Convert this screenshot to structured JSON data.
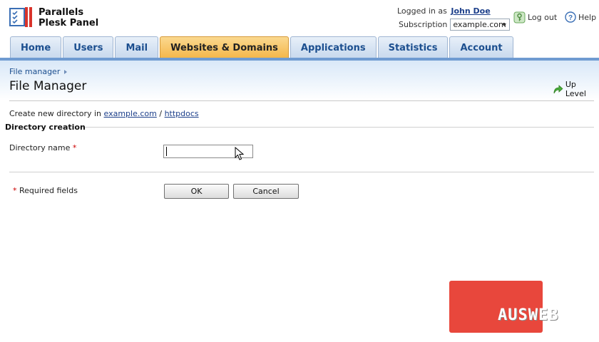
{
  "app": {
    "name_line1": "Parallels",
    "name_line2": "Plesk Panel"
  },
  "account": {
    "logged_in_label": "Logged in as",
    "user_name": "John Doe",
    "subscription_label": "Subscription",
    "subscription_value": "example.com",
    "logout_label": "Log out",
    "help_label": "Help"
  },
  "tabs": [
    {
      "label": "Home"
    },
    {
      "label": "Users"
    },
    {
      "label": "Mail"
    },
    {
      "label": "Websites & Domains",
      "active": true
    },
    {
      "label": "Applications"
    },
    {
      "label": "Statistics"
    },
    {
      "label": "Account"
    }
  ],
  "page": {
    "breadcrumb": "File manager",
    "title": "File Manager",
    "up_level_label": "Up Level",
    "create_in_text": "Create new directory in",
    "path_domain": "example.com",
    "path_separator": "/",
    "path_folder": "httpdocs"
  },
  "form": {
    "section_title": "Directory creation",
    "field_label": "Directory name",
    "required_mark": "*",
    "field_value": "",
    "required_note": "Required fields",
    "ok_label": "OK",
    "cancel_label": "Cancel"
  },
  "watermark": {
    "text": "AUSWEB"
  },
  "colors": {
    "tab_active": "#f4b649",
    "tab_inactive": "#c7d8ed",
    "tab_text": "#1c4f8f",
    "link": "#1c3f8a",
    "required": "#cc0000",
    "watermark": "#e8473c"
  }
}
